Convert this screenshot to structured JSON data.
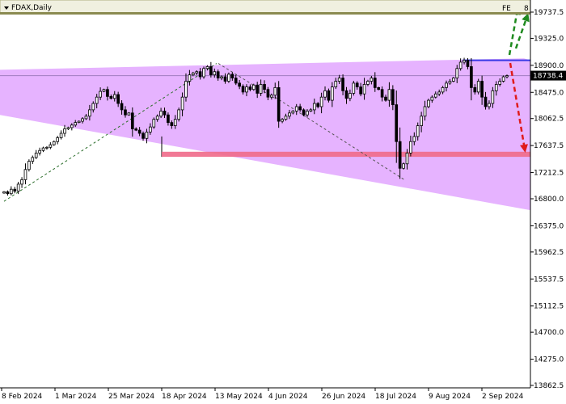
{
  "header": {
    "symbol_label": "FDAX,Daily",
    "fe_label": "FE",
    "hint_label": "8"
  },
  "colors": {
    "background": "#ffffff",
    "axis": "#000000",
    "channel_fill": "#e6b3ff",
    "support_zone": "#f06a8a",
    "resistance_line": "#3a3ae6",
    "price_line": "#a07cc0",
    "up_arrow": "#1f8a1f",
    "down_arrow": "#e01b1b",
    "trendline": "#2b6e2b"
  },
  "chart_data": {
    "type": "candlestick",
    "symbol": "FDAX",
    "timeframe": "Daily",
    "x_tick_labels": [
      "8 Feb 2024",
      "1 Mar 2024",
      "25 Mar 2024",
      "18 Apr 2024",
      "13 May 2024",
      "4 Jun 2024",
      "26 Jun 2024",
      "18 Jul 2024",
      "9 Aug 2024",
      "2 Sep 2024"
    ],
    "y_tick_labels": [
      "19737.5",
      "19325.0",
      "18900.0",
      "18475.0",
      "18062.5",
      "17637.5",
      "17212.5",
      "16800.0",
      "16375.0",
      "15962.5",
      "15537.5",
      "15112.5",
      "14700.0",
      "14275.0",
      "13862.5"
    ],
    "ylim": [
      13862.5,
      20100
    ],
    "current_price_label": "18738.4",
    "current_price": 18738.4,
    "support_level": 17500,
    "resistance_level": 18980,
    "closes": [
      16910,
      16880,
      16950,
      16920,
      17030,
      17100,
      17260,
      17390,
      17450,
      17520,
      17560,
      17600,
      17610,
      17650,
      17700,
      17760,
      17830,
      17900,
      17920,
      17960,
      18000,
      18020,
      18060,
      18100,
      18200,
      18300,
      18400,
      18490,
      18520,
      18410,
      18380,
      18440,
      18300,
      18200,
      18120,
      18150,
      17900,
      17880,
      17830,
      17750,
      17850,
      17930,
      18050,
      18100,
      18180,
      18120,
      18000,
      17950,
      18050,
      18200,
      18400,
      18650,
      18750,
      18780,
      18800,
      18720,
      18850,
      18880,
      18750,
      18800,
      18700,
      18720,
      18650,
      18760,
      18700,
      18620,
      18570,
      18480,
      18560,
      18520,
      18590,
      18460,
      18600,
      18520,
      18400,
      18430,
      18550,
      18020,
      18050,
      18100,
      18150,
      18180,
      18250,
      18200,
      18120,
      18180,
      18200,
      18300,
      18250,
      18400,
      18500,
      18350,
      18560,
      18650,
      18700,
      18500,
      18380,
      18460,
      18620,
      18560,
      18450,
      18600,
      18650,
      18700,
      18550,
      18520,
      18400,
      18350,
      18520,
      18280,
      17700,
      17280,
      17350,
      17520,
      17700,
      17780,
      17950,
      18100,
      18250,
      18350,
      18400,
      18450,
      18480,
      18550,
      18620,
      18650,
      18700,
      18850,
      18950,
      18980,
      18880,
      18550,
      18480,
      18650,
      18400,
      18250,
      18300,
      18500,
      18600,
      18650,
      18720,
      18738
    ]
  }
}
